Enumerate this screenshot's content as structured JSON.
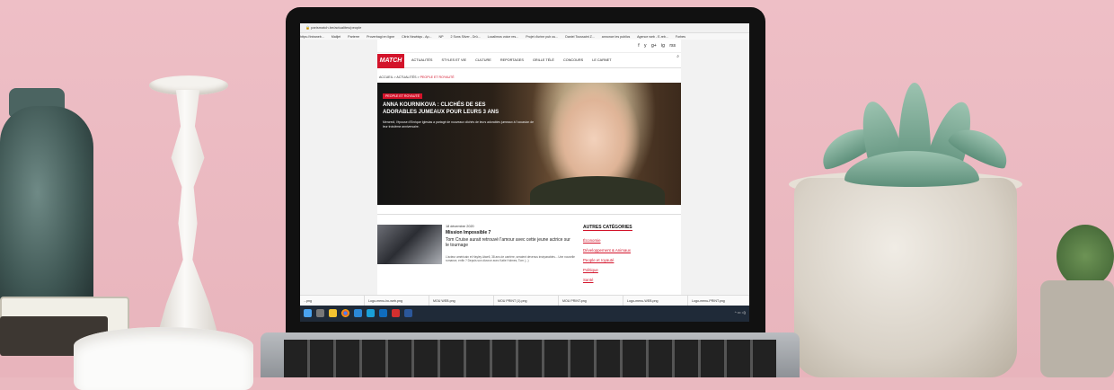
{
  "browser": {
    "url": "parismatch.be/actualites/people",
    "bookmarks": [
      "https://intraneb...",
      "Mailjet",
      "Parterre",
      "Proverbagi en ligne",
      "Citrix Newbiqs - Ap...",
      "NP",
      "2 Sons Silver - Drü...",
      "Localimos voice res...",
      "Projet d'urine pub ou...",
      "Daniel Toussaint Z...",
      "annonce les publics",
      "Agence web - E-reb...",
      "Forbes"
    ]
  },
  "site": {
    "abonne_label": "M'ABONNER",
    "logo": "MATCH",
    "social_icons": [
      "f",
      "y",
      "g+",
      "ig",
      "rss"
    ],
    "nav": [
      "ACTUALITÉS",
      "STYLES ET VIE",
      "CULTURE",
      "REPORTAGES",
      "GRILLE TÉLÉ",
      "CONCOURS",
      "LE CARNET"
    ],
    "breadcrumb": [
      "ACCUEIL",
      "ACTUALITÉS",
      "PEOPLE ET ROYAUTÉ"
    ],
    "hero": {
      "tag": "PEOPLE ET ROYAUTÉ",
      "title": "ANNA KOURNIKOVA : CLICHÉS DE SES ADORABLES JUMEAUX POUR LEURS 3 ANS",
      "desc": "Mercredi, l'épouse d'Enrique Iglesias a partagé de nouveaux clichés de leurs adorables jumeaux à l'occasion de leur troisième anniversaire."
    },
    "article": {
      "date": "18 décembre 2020",
      "title": "Mission Impossible 7",
      "subtitle": "Tom Cruise aurait retrouvé l'amour avec cette jeune actrice sur le tournage",
      "text": "L'acteur américain et Hayley Atwell, 38 ans de carrière, seraient devenus inséparables... Une nouvelle romance, enfin ? Depuis son divorce avec Katie Holmes, Tom (...)"
    },
    "categories": {
      "title": "AUTRES CATÉGORIES",
      "items": [
        "Économie",
        "Développement & Animaux",
        "People et royauté",
        "Politique",
        "Santé"
      ]
    }
  },
  "downloads": [
    "...png",
    "Logo-menu-bc-web.png",
    "MOU WEB.png",
    "MOU PRINT (1).png",
    "MOU PRINT.png",
    "Logo-menu-WEB.png",
    "Logo-menu-PRINT.png"
  ],
  "taskbar": {
    "icons": [
      "windows-icon",
      "search-icon",
      "explorer-icon",
      "chrome-icon",
      "store-icon",
      "photos-icon",
      "outlook-icon",
      "acrobat-icon",
      "word-icon"
    ],
    "tray": "^ ▭ ◁)"
  },
  "colors": {
    "accent": "#d3132a",
    "wall": "#eab9c0",
    "taskbar": "#1f2a38"
  }
}
